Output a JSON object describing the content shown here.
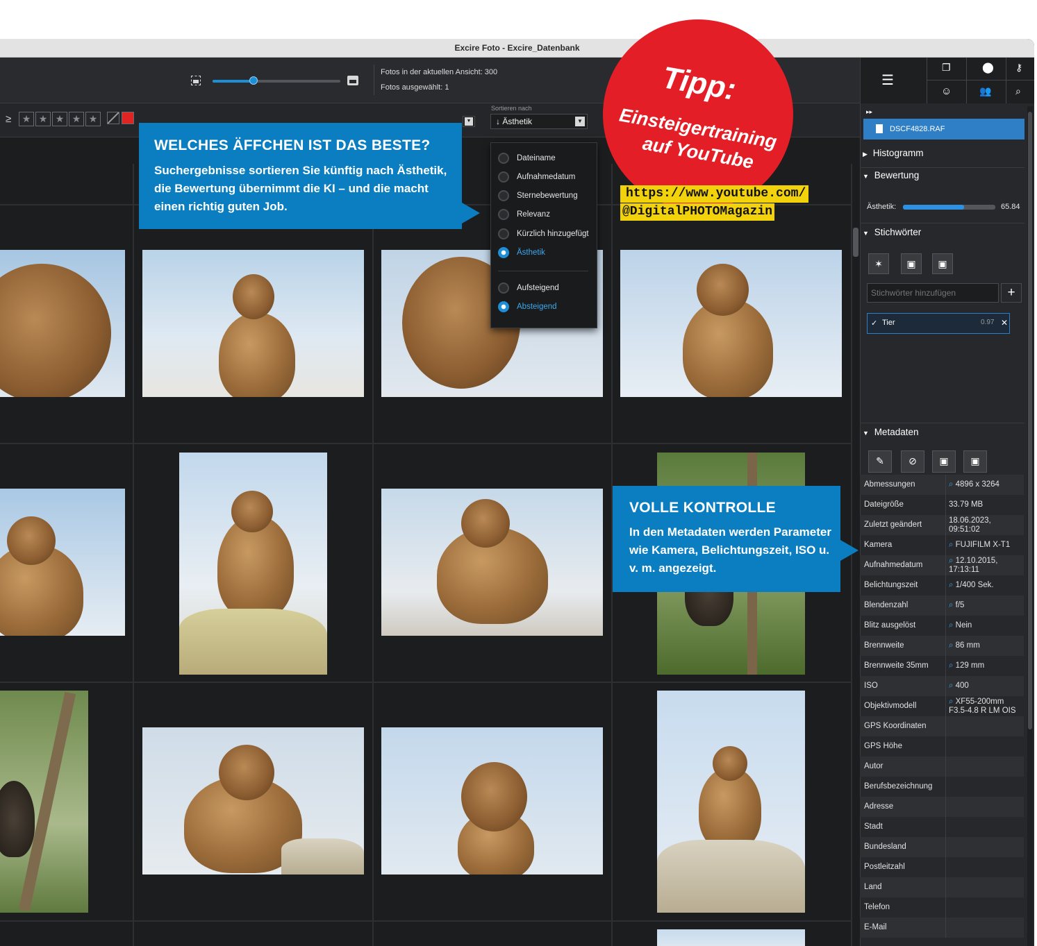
{
  "window": {
    "title": "Excire Foto - Excire_Datenbank"
  },
  "toolbar": {
    "photos_in_view": "Fotos in der aktuellen Ansicht: 300",
    "photos_selected": "Fotos ausgewählt: 1",
    "zoom_fraction": 0.32
  },
  "filterbar": {
    "rating_prefix": "≥",
    "sort_label": "Sortieren nach",
    "sort_value": "↓ Ästhetik"
  },
  "sort_menu": {
    "options": [
      "Dateiname",
      "Aufnahmedatum",
      "Sternebewertung",
      "Relevanz",
      "Kürzlich hinzugefügt",
      "Ästhetik"
    ],
    "selected_option": "Ästhetik",
    "order": [
      "Aufsteigend",
      "Absteigend"
    ],
    "selected_order": "Absteigend"
  },
  "callouts": {
    "sort": {
      "title": "WELCHES ÄFFCHEN IST DAS BESTE?",
      "body": "Suchergebnisse sortieren Sie künftig nach Ästhetik, die Bewertung übernimmt die KI – und die macht einen richtig guten Job."
    },
    "meta": {
      "title": "VOLLE KONTROLLE",
      "body": "In den Metadaten werden Parameter wie Kamera, Belichtungszeit, ISO u. v. m. angezeigt."
    }
  },
  "tip": {
    "title": "Tipp:",
    "line1": "Einsteigertraining",
    "line2": "auf YouTube",
    "url1": "https://www.youtube.com/",
    "url2": "@DigitalPHOTOMagazin"
  },
  "sidebar": {
    "file_name": "DSCF4828.RAF",
    "sections": {
      "histogram": "Histogramm",
      "rating": "Bewertung",
      "keywords": "Stichwörter",
      "metadata": "Metadaten"
    },
    "aesthetics": {
      "label": "Ästhetik:",
      "value": "65.84",
      "fraction": 0.6584
    },
    "keyword_placeholder": "Stichwörter hinzufügen",
    "keyword_tag": {
      "name": "Tier",
      "score": "0.97"
    },
    "metadata": [
      {
        "key": "Abmessungen",
        "value": "4896 x 3264",
        "search": true
      },
      {
        "key": "Dateigröße",
        "value": "33.79 MB",
        "search": false
      },
      {
        "key": "Zuletzt geändert",
        "value": "18.06.2023, 09:51:02",
        "search": false
      },
      {
        "key": "Kamera",
        "value": "FUJIFILM X-T1",
        "search": true
      },
      {
        "key": "Aufnahmedatum",
        "value": "12.10.2015, 17:13:11",
        "search": true
      },
      {
        "key": "Belichtungszeit",
        "value": "1/400 Sek.",
        "search": true
      },
      {
        "key": "Blendenzahl",
        "value": "f/5",
        "search": true
      },
      {
        "key": "Blitz ausgelöst",
        "value": "Nein",
        "search": true
      },
      {
        "key": "Brennweite",
        "value": "86 mm",
        "search": true
      },
      {
        "key": "Brennweite 35mm",
        "value": "129 mm",
        "search": true
      },
      {
        "key": "ISO",
        "value": "400",
        "search": true
      },
      {
        "key": "Objektivmodell",
        "value": "XF55-200mm F3.5-4.8 R LM OIS",
        "search": true
      },
      {
        "key": "GPS Koordinaten",
        "value": "",
        "search": false
      },
      {
        "key": "GPS Höhe",
        "value": "",
        "search": false
      },
      {
        "key": "Autor",
        "value": "",
        "search": false
      },
      {
        "key": "Berufsbezeichnung",
        "value": "",
        "search": false
      },
      {
        "key": "Adresse",
        "value": "",
        "search": false
      },
      {
        "key": "Stadt",
        "value": "",
        "search": false
      },
      {
        "key": "Bundesland",
        "value": "",
        "search": false
      },
      {
        "key": "Postleitzahl",
        "value": "",
        "search": false
      },
      {
        "key": "Land",
        "value": "",
        "search": false
      },
      {
        "key": "Telefon",
        "value": "",
        "search": false
      },
      {
        "key": "E-Mail",
        "value": "",
        "search": false
      }
    ]
  },
  "colors": {
    "accent": "#1e8fd6",
    "callout": "#0a7ec0",
    "tip_red": "#e41e26",
    "url_highlight": "#f2d20a"
  }
}
